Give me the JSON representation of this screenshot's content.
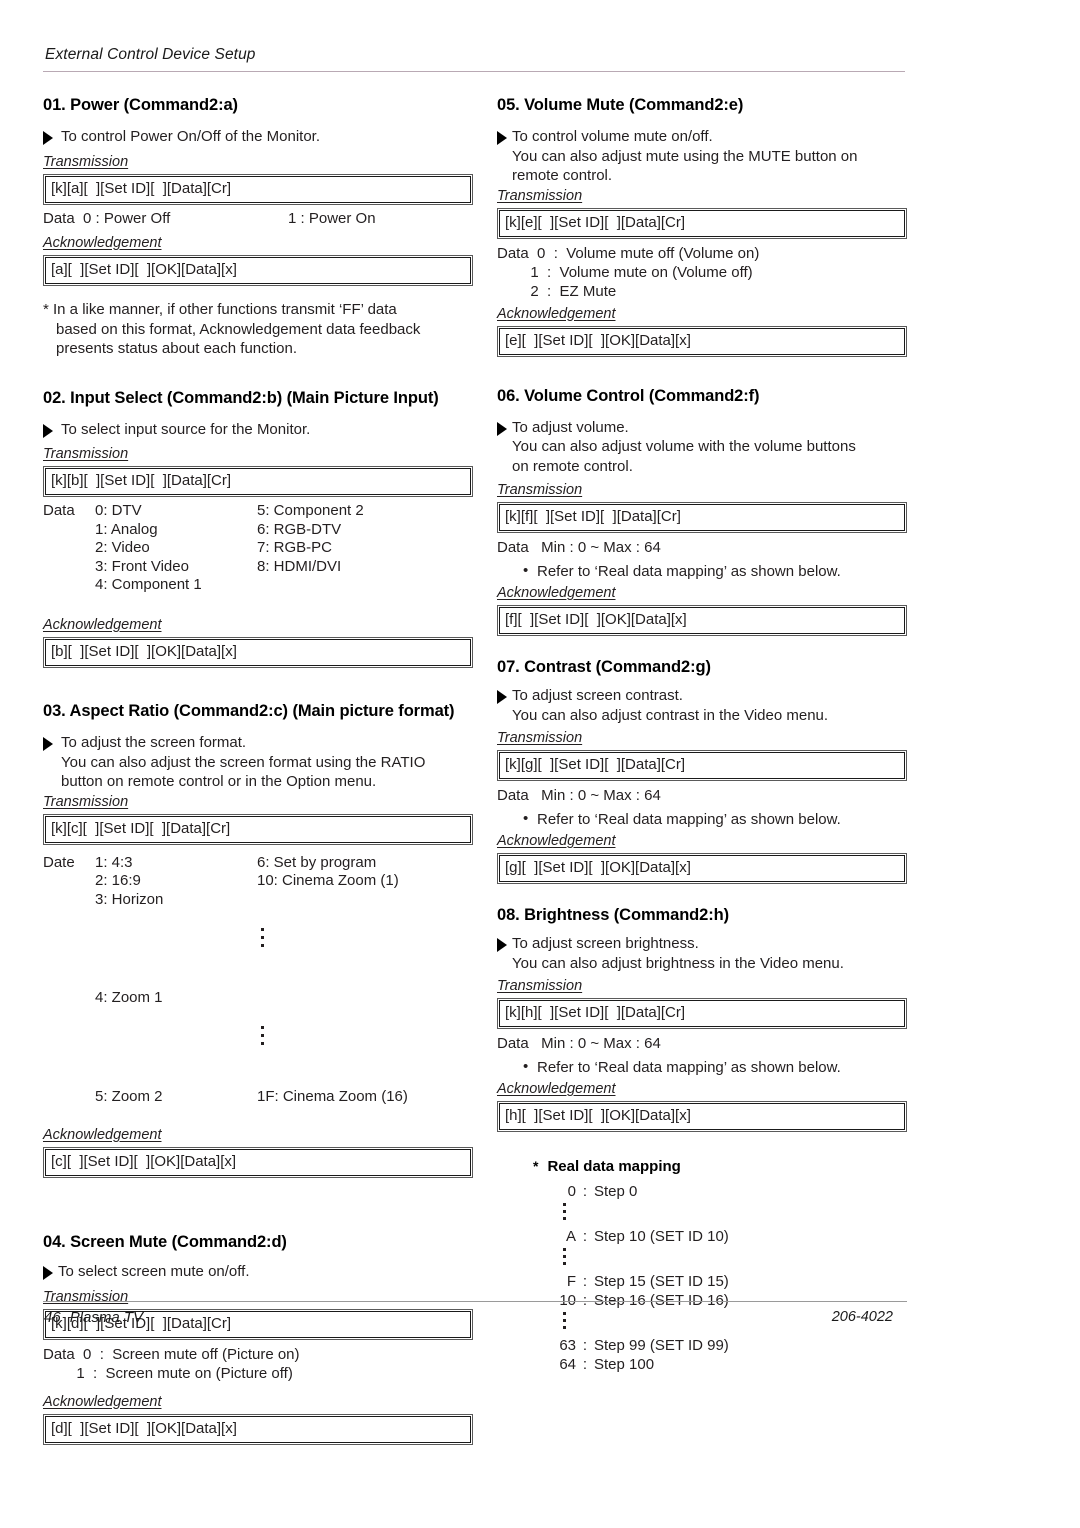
{
  "header": {
    "running_head": "External Control Device Setup"
  },
  "footer": {
    "page_number": "46",
    "product": "Plasma TV",
    "doc_code": "206-4022"
  },
  "sections": {
    "s01": {
      "title": "01. Power (Command2:a)",
      "desc": "To control Power On/Off of the Monitor.",
      "transmission_label": "Transmission",
      "transmission_code": "[k][a][  ][Set ID][  ][Data][Cr]",
      "data_left": "Data  0 : Power Off",
      "data_right": "1 : Power On",
      "ack_label": "Acknowledgement",
      "ack_code": "[a][  ][Set ID][  ][OK][Data][x]",
      "note_line1": "* In a like manner, if other functions transmit ‘FF’ data",
      "note_line2": "based on this format, Acknowledgement data feedback",
      "note_line3": "presents status about each function."
    },
    "s02": {
      "title": "02. Input Select (Command2:b) (Main Picture Input)",
      "desc": "To select input source for the Monitor.",
      "transmission_label": "Transmission",
      "transmission_code": "[k][b][  ][Set ID][  ][Data][Cr]",
      "data_lead": "Data",
      "col1": [
        "0: DTV",
        "1: Analog",
        "2: Video",
        "3: Front Video",
        "4: Component 1"
      ],
      "col2": [
        "5: Component 2",
        "6: RGB-DTV",
        "7: RGB-PC",
        "8: HDMI/DVI",
        ""
      ],
      "ack_label": "Acknowledgement",
      "ack_code": "[b][  ][Set ID][  ][OK][Data][x]"
    },
    "s03": {
      "title": "03. Aspect Ratio (Command2:c) (Main picture format)",
      "desc": "To adjust the screen format.",
      "desc2": "You can also adjust the screen format using the RATIO",
      "desc3": "button on remote control or in the Option menu.",
      "transmission_label": "Transmission",
      "transmission_code": "[k][c][  ][Set ID][  ][Data][Cr]",
      "data_lead": "Date",
      "col1": [
        "1: 4:3",
        "2: 16:9",
        "3: Horizon",
        "4: Zoom 1",
        "5: Zoom 2"
      ],
      "col2": [
        "6: Set by program",
        "10: Cinema Zoom (1)",
        "",
        "",
        "1F: Cinema Zoom (16)"
      ],
      "ack_label": "Acknowledgement",
      "ack_code": "[c][  ][Set ID][  ][OK][Data][x]"
    },
    "s04": {
      "title": "04. Screen Mute (Command2:d)",
      "desc": "To select screen mute on/off.",
      "transmission_label": "Transmission",
      "transmission_code": "[k][d][  ][Set ID][  ][Data][Cr]",
      "data_line1": "Data  0  :  Screen mute off (Picture on)",
      "data_line2": "        1  :  Screen mute on (Picture off)",
      "ack_label": "Acknowledgement",
      "ack_code": "[d][  ][Set ID][  ][OK][Data][x]"
    },
    "s05": {
      "title": "05. Volume Mute (Command2:e)",
      "desc": "To control volume mute on/off.",
      "desc2": "You can also adjust mute using the MUTE button on",
      "desc3": "remote control.",
      "transmission_label": "Transmission",
      "transmission_code": "[k][e][  ][Set ID][  ][Data][Cr]",
      "data_line1": "Data  0  :  Volume mute off (Volume on)",
      "data_line2": "        1  :  Volume mute on (Volume off)",
      "data_line3": "        2  :  EZ Mute",
      "ack_label": "Acknowledgement",
      "ack_code": "[e][  ][Set ID][  ][OK][Data][x]"
    },
    "s06": {
      "title": "06. Volume Control (Command2:f)",
      "desc": "To adjust volume.",
      "desc2": "You can also adjust volume with the volume buttons",
      "desc3": "on remote control.",
      "transmission_label": "Transmission",
      "transmission_code": "[k][f][  ][Set ID][  ][Data][Cr]",
      "data_line1": "Data   Min : 0 ~ Max : 64",
      "refer_note": "Refer to ‘Real data mapping’ as shown below.",
      "ack_label": "Acknowledgement",
      "ack_code": "[f][  ][Set ID][  ][OK][Data][x]"
    },
    "s07": {
      "title": "07. Contrast (Command2:g)",
      "desc": "To adjust screen contrast.",
      "desc2": "You can also adjust contrast in the Video menu.",
      "transmission_label": "Transmission",
      "transmission_code": "[k][g][  ][Set ID][  ][Data][Cr]",
      "data_line1": "Data   Min : 0 ~ Max : 64",
      "refer_note": "Refer to ‘Real data mapping’ as shown below.",
      "ack_label": "Acknowledgement",
      "ack_code": "[g][  ][Set ID][  ][OK][Data][x]"
    },
    "s08": {
      "title": "08. Brightness (Command2:h)",
      "desc": "To adjust screen brightness.",
      "desc2": "You can also adjust brightness in the Video menu.",
      "transmission_label": "Transmission",
      "transmission_code": "[k][h][  ][Set ID][  ][Data][Cr]",
      "data_line1": "Data   Min : 0 ~ Max : 64",
      "refer_note": "Refer to ‘Real data mapping’ as shown below.",
      "ack_label": "Acknowledgement",
      "ack_code": "[h][  ][Set ID][  ][OK][Data][x]"
    }
  },
  "real_data_mapping": {
    "star": "*",
    "title": "Real data mapping",
    "rows": [
      {
        "key": "0",
        "sep": ":",
        "value": "Step 0",
        "dots_after": true
      },
      {
        "key": "A",
        "sep": ":",
        "value": "Step 10 (SET ID 10)",
        "dots_after": true
      },
      {
        "key": "F",
        "sep": ":",
        "value": "Step 15 (SET ID 15)",
        "dots_after": false
      },
      {
        "key": "10",
        "sep": ":",
        "value": "Step 16 (SET ID 16)",
        "dots_after": true
      },
      {
        "key": "63",
        "sep": ":",
        "value": "Step 99 (SET ID 99)",
        "dots_after": false
      },
      {
        "key": "64",
        "sep": ":",
        "value": "Step 100",
        "dots_after": false
      }
    ]
  }
}
